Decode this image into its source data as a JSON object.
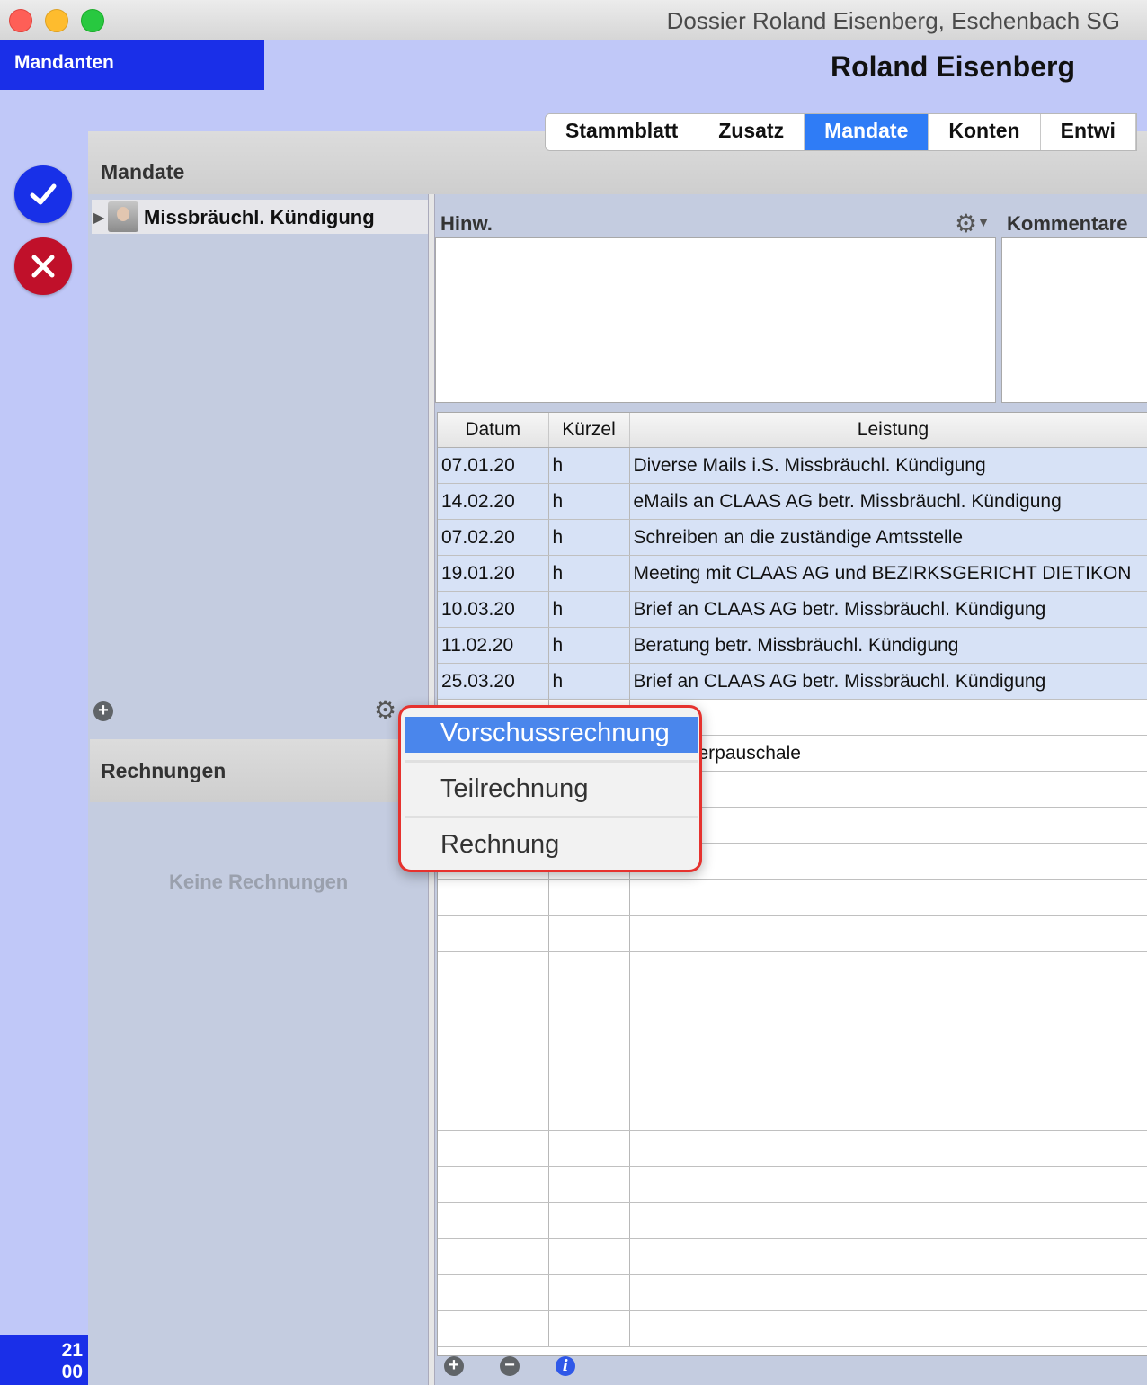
{
  "window": {
    "title": "Dossier Roland Eisenberg, Eschenbach SG"
  },
  "header": {
    "mandanten_label": "Mandanten",
    "client_name": "Roland Eisenberg"
  },
  "tabs": [
    {
      "label": "Stammblatt"
    },
    {
      "label": "Zusatz"
    },
    {
      "label": "Mandate"
    },
    {
      "label": "Konten"
    },
    {
      "label": "Entwi"
    }
  ],
  "active_tab": "Mandate",
  "mandate_section": {
    "title": "Mandate",
    "items": [
      {
        "label": "Missbräuchl. Kündigung"
      }
    ]
  },
  "invoices_section": {
    "title": "Rechnungen",
    "empty_text": "Keine Rechnungen"
  },
  "notes": {
    "hinw_label": "Hinw.",
    "kommentare_label": "Kommentare"
  },
  "table": {
    "columns": [
      "Datum",
      "Kürzel",
      "Leistung"
    ],
    "rows": [
      {
        "datum": "07.01.20",
        "kuerzel": "h",
        "leistung": "Diverse Mails i.S. Missbräuchl. Kündigung"
      },
      {
        "datum": "14.02.20",
        "kuerzel": "h",
        "leistung": "eMails an CLAAS AG betr. Missbräuchl. Kündigung"
      },
      {
        "datum": "07.02.20",
        "kuerzel": "h",
        "leistung": "Schreiben an die zuständige Amtsstelle"
      },
      {
        "datum": "19.01.20",
        "kuerzel": "h",
        "leistung": "Meeting mit CLAAS AG und BEZIRKSGERICHT DIETIKON"
      },
      {
        "datum": "10.03.20",
        "kuerzel": "h",
        "leistung": "Brief an CLAAS AG betr. Missbräuchl. Kündigung"
      },
      {
        "datum": "11.02.20",
        "kuerzel": "h",
        "leistung": "Beratung betr. Missbräuchl. Kündigung"
      },
      {
        "datum": "25.03.20",
        "kuerzel": "h",
        "leistung": "Brief an CLAAS AG betr. Missbräuchl. Kündigung"
      }
    ],
    "partial_row_text": "erpauschale"
  },
  "popup_menu": {
    "items": [
      "Vorschussrechnung",
      "Teilrechnung",
      "Rechnung"
    ],
    "selected": "Vorschussrechnung"
  },
  "counter": {
    "line1": "21",
    "line2": "00"
  },
  "icons": {
    "confirm": "checkmark-icon",
    "cancel": "x-icon",
    "gear": "gear-icon",
    "add": "plus-icon",
    "remove": "minus-icon",
    "info": "info-icon"
  },
  "colors": {
    "accent_blue": "#1a2fe8",
    "tab_active": "#2f7cf6",
    "cancel_red": "#c0102a",
    "row_fill": "#d7e2f6",
    "highlight_border": "#e6322e"
  }
}
